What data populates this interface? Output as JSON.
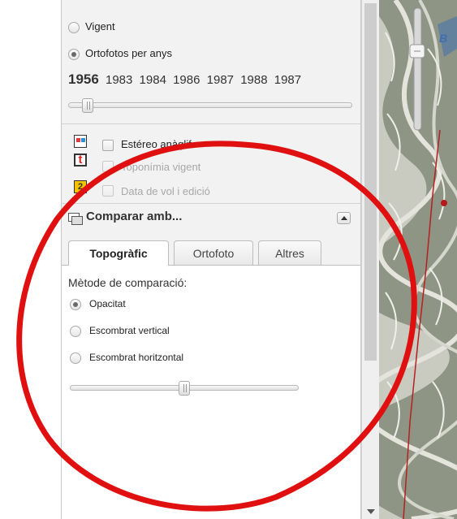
{
  "view": {
    "options": [
      {
        "label": "Vigent",
        "checked": false
      },
      {
        "label": "Ortofotos per anys",
        "checked": true
      }
    ],
    "years": {
      "selected": "1956",
      "others": [
        "1983",
        "1984",
        "1986",
        "1987",
        "1988",
        "1987"
      ]
    },
    "year_slider_position": 0.05
  },
  "layers": [
    {
      "icon": "stereo-icon",
      "label": "Estéreo anàglif",
      "enabled": true
    },
    {
      "icon": "toponymy-icon",
      "glyph": "t",
      "label": "Toponímia vigent",
      "enabled": false
    },
    {
      "icon": "flight-date-icon",
      "glyph": "2",
      "label": "Data de vol i edició",
      "enabled": false
    }
  ],
  "compare": {
    "title": "Comparar amb...",
    "tabs": [
      {
        "label": "Topogràfic",
        "active": true
      },
      {
        "label": "Ortofoto",
        "active": false
      },
      {
        "label": "Altres",
        "active": false
      }
    ],
    "method_label": "Mètode de comparació:",
    "methods": [
      {
        "label": "Opacitat",
        "checked": true
      },
      {
        "label": "Escombrat vertical",
        "checked": false
      },
      {
        "label": "Escombrat horitzontal",
        "checked": false
      }
    ],
    "opacity_slider_position": 0.5
  },
  "colors": {
    "annotation": "#e01010",
    "panel_bg": "#f2f2f2",
    "active_tab_bg": "#ffffff"
  }
}
